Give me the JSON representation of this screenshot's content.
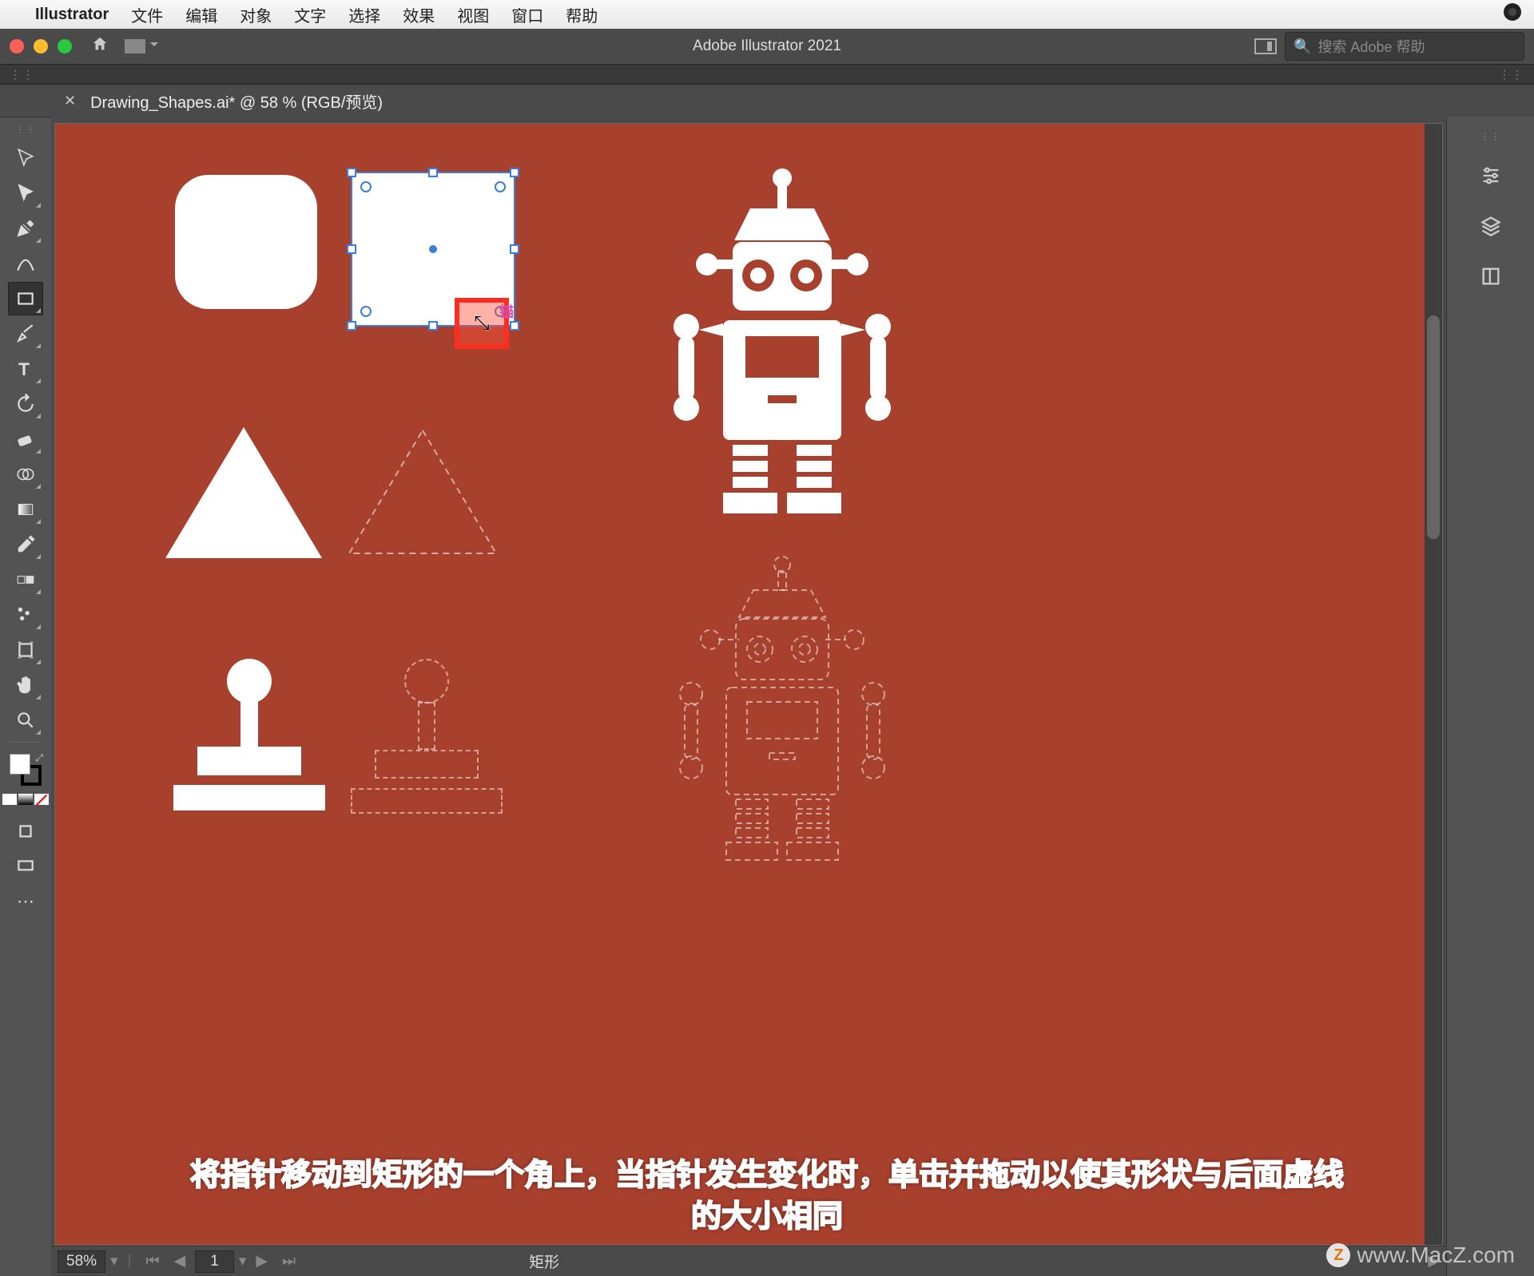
{
  "menubar": {
    "app": "Illustrator",
    "items": [
      "文件",
      "编辑",
      "对象",
      "文字",
      "选择",
      "效果",
      "视图",
      "窗口",
      "帮助"
    ]
  },
  "titlebar": {
    "title": "Adobe Illustrator 2021",
    "search_placeholder": "搜索 Adobe 帮助"
  },
  "tab": {
    "filename": "Drawing_Shapes.ai* @ 58 % (RGB/预览)"
  },
  "canvas": {
    "cursor_label": "锚",
    "selected_shape": {
      "type": "rectangle",
      "corner_widgets": true
    }
  },
  "statusbar": {
    "zoom": "58%",
    "artboard": "1",
    "shape_name": "矩形"
  },
  "instruction": {
    "line1": "将指针移动到矩形的一个角上，当指针发生变化时，单击并拖动以使其形状与后面虚线",
    "line2": "的大小相同"
  },
  "watermark": "www.MacZ.com",
  "dock": {
    "icons": [
      "properties",
      "layers",
      "libraries"
    ]
  },
  "tools": [
    "selection",
    "direct-selection",
    "pen",
    "curvature",
    "rectangle",
    "paintbrush",
    "type",
    "rotate",
    "eraser",
    "shape-builder",
    "gradient",
    "eyedropper",
    "blend",
    "symbol-sprayer",
    "artboard",
    "hand",
    "zoom"
  ],
  "colors": {
    "canvas_bg": "#a8402e",
    "selection": "#3b7dd8",
    "highlight_box": "#ff2d1f"
  }
}
